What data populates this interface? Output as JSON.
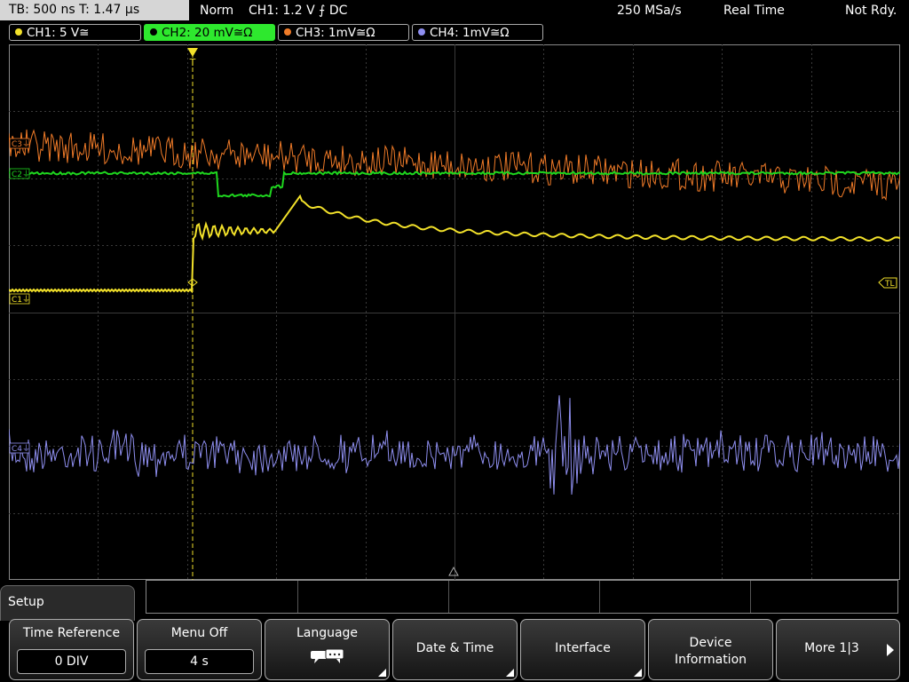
{
  "top": {
    "timebase": "TB: 500 ns   T: 1.47 µs",
    "mode": "Norm",
    "trigger": "CH1: 1.2 V ⨍ DC",
    "sample_rate": "250 MSa/s",
    "acq_mode": "Real Time",
    "status": "Not Rdy."
  },
  "channels": [
    {
      "label": "CH1: 5 V≅",
      "color": "#f2e12a"
    },
    {
      "label": "CH2: 20 mV≅Ω",
      "color": "#1ed61e"
    },
    {
      "label": "CH3: 1mV≅Ω",
      "color": "#f07b28"
    },
    {
      "label": "CH4: 1mV≅Ω",
      "color": "#8f8ff0"
    }
  ],
  "markers": {
    "c1": "C1⏚",
    "c2": "C2⏚",
    "c3": "C3⏚",
    "c4": "C4⏚",
    "tl": "TL"
  },
  "menu": {
    "title": "Setup",
    "keys": {
      "time_reference": {
        "label": "Time Reference",
        "value": "0 DIV"
      },
      "menu_off": {
        "label": "Menu Off",
        "value": "4 s"
      },
      "language": {
        "label": "Language"
      },
      "date_time": {
        "label": "Date & Time"
      },
      "interface": {
        "label": "Interface"
      },
      "device_info": {
        "line1": "Device",
        "line2": "Information"
      },
      "more": {
        "label": "More 1|3"
      }
    }
  }
}
